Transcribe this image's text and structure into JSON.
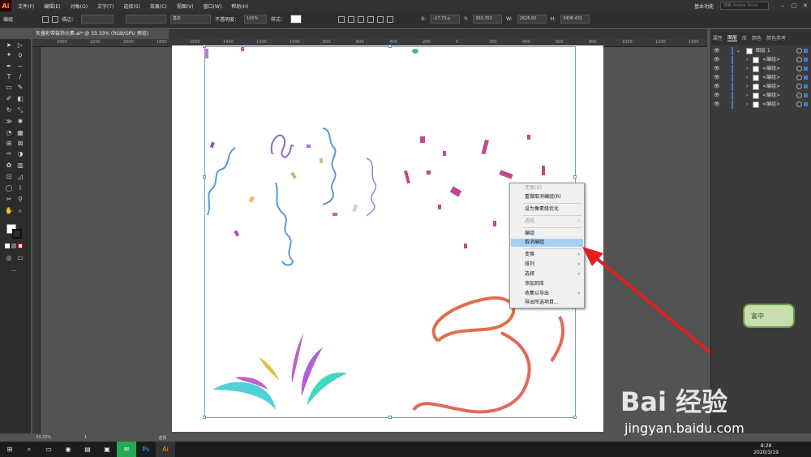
{
  "menubar": {
    "logo": "Ai",
    "items": [
      "文件(F)",
      "编辑(E)",
      "对象(O)",
      "文字(T)",
      "选择(S)",
      "效果(C)",
      "视图(V)",
      "窗口(W)",
      "帮助(H)"
    ],
    "workspace": "基本功能",
    "search_placeholder": "搜索 Adobe Stock"
  },
  "control": {
    "group_label": "编组",
    "stroke_label": "描边：",
    "style_label": "基本",
    "opacity_label": "不透明度：",
    "opacity": "100%",
    "style2": "样式：",
    "x_label": "X:",
    "x": "-27.73 p",
    "y_label": "Y:",
    "y": "300.702",
    "w_label": "W:",
    "w": "2628.82",
    "h_label": "H:",
    "h": "3408.431"
  },
  "document": {
    "tab": "矢量彩带装饰元素.ai* @ 33.33% (RGB/GPU 预览)",
    "zoom": "33.33%",
    "page": "1",
    "status": "选择"
  },
  "ruler": {
    "h": [
      "2400",
      "2200",
      "2000",
      "1800",
      "1600",
      "1400",
      "1200",
      "1000",
      "800",
      "600",
      "400",
      "200",
      "0",
      "200",
      "400",
      "600",
      "800",
      "1000",
      "1200",
      "1400"
    ]
  },
  "context_menu": {
    "items": [
      {
        "label": "还原(U)",
        "disabled": true
      },
      {
        "label": "重做取消编组(R)",
        "disabled": false
      },
      {
        "label": "设为像素级优化",
        "disabled": false
      },
      {
        "label": "透视",
        "disabled": true,
        "arrow": true
      },
      {
        "label": "编组",
        "disabled": false
      },
      {
        "label": "取消编组",
        "disabled": false,
        "highlight": true
      },
      {
        "label": "变换",
        "disabled": false,
        "arrow": true
      },
      {
        "label": "排列",
        "disabled": false,
        "arrow": true
      },
      {
        "label": "选择",
        "disabled": false,
        "arrow": true
      },
      {
        "label": "添加到库",
        "disabled": false
      },
      {
        "label": "收集以导出",
        "disabled": false,
        "arrow": true
      },
      {
        "label": "导出所选项目...",
        "disabled": false
      }
    ]
  },
  "panel": {
    "tabs": [
      "属性",
      "图层",
      "库",
      "颜色",
      "颜色参考"
    ],
    "active_tab": "图层",
    "top_layer": "图层 1",
    "groups": [
      "<编组>",
      "<编组>",
      "<编组>",
      "<编组>",
      "<编组>",
      "<编组>"
    ]
  },
  "taskbar": {
    "time": "8:28",
    "date": "2020/3/19"
  },
  "watermark": {
    "text": "Bai 经验",
    "url": "jingyan.baidu.com",
    "badge": "富中"
  },
  "colors": {
    "highlight": "#a7cff5",
    "selection": "#4a78c8",
    "ribbon_blue": "#5a9ad8",
    "ribbon_purple": "#8a6ac8",
    "ribbon_pink": "#c04890",
    "ribbon_orange": "#e0704a",
    "ribbon_cyan": "#50d0d0",
    "arrow_red": "#e02020"
  }
}
